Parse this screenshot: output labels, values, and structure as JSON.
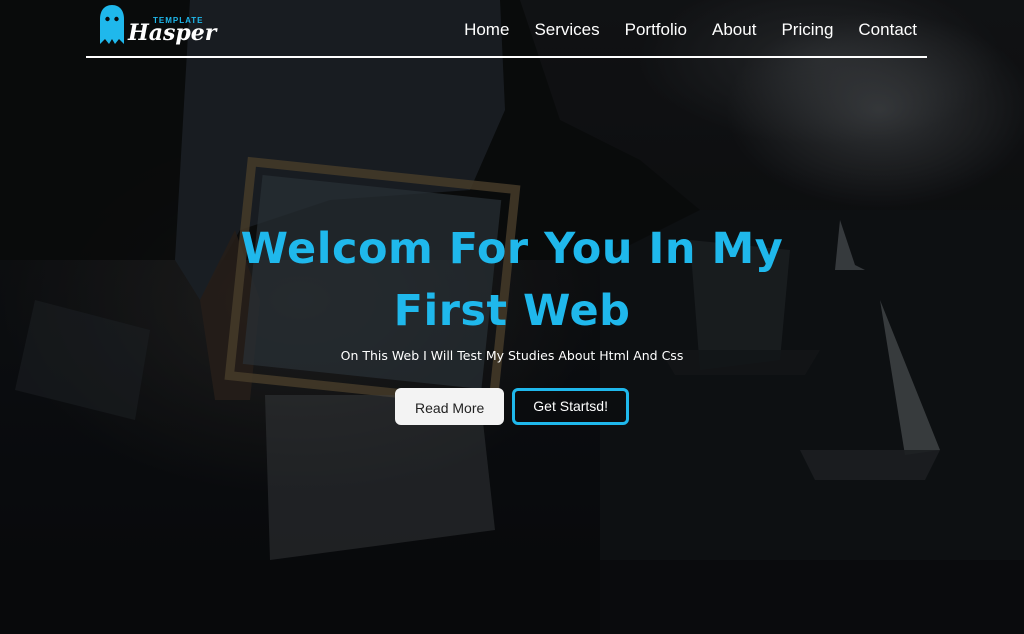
{
  "brand": {
    "logo_small": "TEMPLATE",
    "logo_name": "Hasper"
  },
  "nav": {
    "items": [
      "Home",
      "Services",
      "Portfolio",
      "About",
      "Pricing",
      "Contact"
    ]
  },
  "hero": {
    "title_line1": "Welcom For You In My",
    "title_line2": "First Web",
    "subtitle": "On This Web I Will Test My Studies About Html And Css",
    "read_more": "Read More",
    "get_started": "Get Startsd!"
  },
  "colors": {
    "accent": "#1fb8ec",
    "text": "#ffffff",
    "button_light": "#f3f3f3"
  },
  "icons": {
    "logo": "ghost-icon"
  }
}
